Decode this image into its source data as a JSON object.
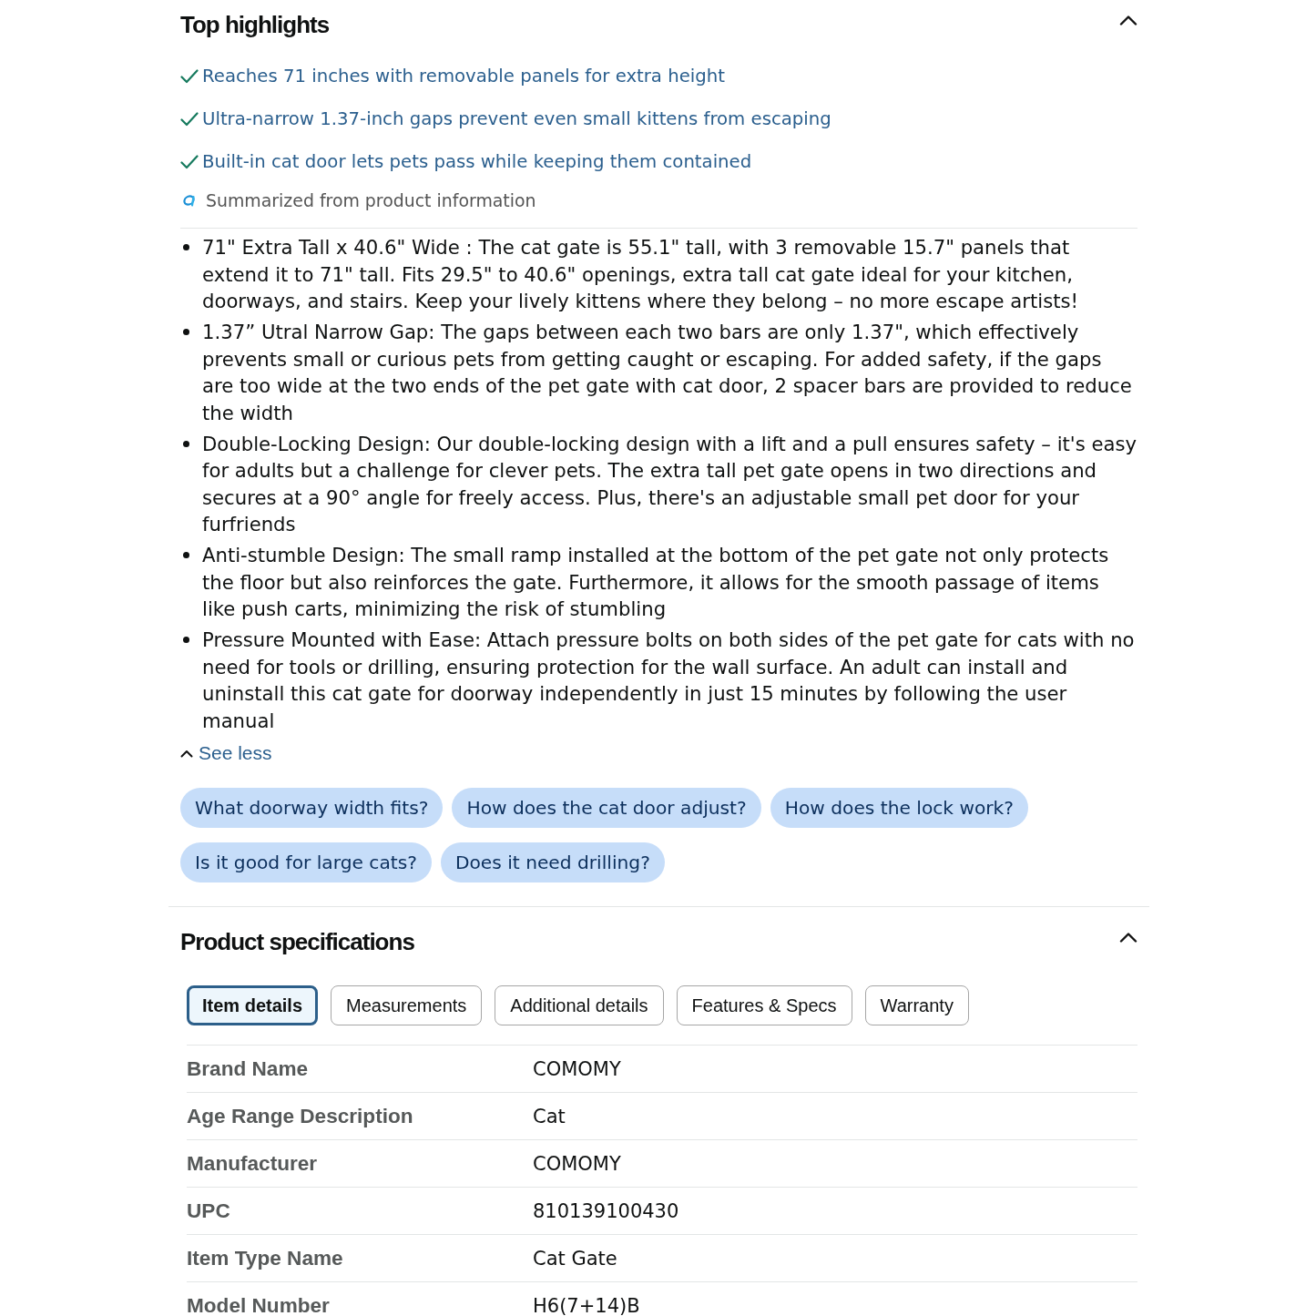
{
  "highlights": {
    "title": "Top highlights",
    "expanded": true,
    "items": [
      "Reaches 71 inches with removable panels for extra height",
      "Ultra-narrow 1.37-inch gaps prevent even small kittens from escaping",
      "Built-in cat door lets pets pass while keeping them contained"
    ],
    "source_note": "Summarized from product information"
  },
  "bullets": [
    "71\" Extra Tall x 40.6\" Wide : The cat gate is 55.1\" tall, with 3 removable 15.7\" panels that extend it to 71\" tall. Fits 29.5\" to 40.6\" openings, extra tall cat gate ideal for your kitchen, doorways, and stairs. Keep your lively kittens where they belong – no more escape artists!",
    "1.37” Utral Narrow Gap: The gaps between each two bars are only 1.37\", which effectively prevents small or curious pets from getting caught or escaping. For added safety, if the gaps are too wide at the two ends of the pet gate with cat door, 2 spacer bars are provided to reduce the width",
    "Double-Locking Design: Our double-locking design with a lift and a pull ensures safety – it's easy for adults but a challenge for clever pets. The extra tall pet gate opens in two directions and secures at a 90° angle for freely access. Plus, there's an adjustable small pet door for your furfriends",
    "Anti-stumble Design: The small ramp installed at the bottom of the pet gate not only protects the floor but also reinforces the gate. Furthermore, it allows for the smooth passage of items like push carts, minimizing the risk of stumbling",
    "Pressure Mounted with Ease: Attach pressure bolts on both sides of the pet gate for cats with no need for tools or drilling, ensuring protection for the wall surface. An adult can install and uninstall this cat gate for doorway independently in just 15 minutes by following the user manual"
  ],
  "see_less": "See less",
  "suggested_questions": [
    "What doorway width fits?",
    "How does the cat door adjust?",
    "How does the lock work?",
    "Is it good for large cats?",
    "Does it need drilling?"
  ],
  "specifications": {
    "title": "Product specifications",
    "expanded": true,
    "tabs": [
      {
        "label": "Item details",
        "selected": true
      },
      {
        "label": "Measurements",
        "selected": false
      },
      {
        "label": "Additional details",
        "selected": false
      },
      {
        "label": "Features & Specs",
        "selected": false
      },
      {
        "label": "Warranty",
        "selected": false
      }
    ],
    "rows": [
      {
        "label": "Brand Name",
        "value": "COMOMY"
      },
      {
        "label": "Age Range Description",
        "value": "Cat"
      },
      {
        "label": "Manufacturer",
        "value": "COMOMY"
      },
      {
        "label": "UPC",
        "value": "810139100430"
      },
      {
        "label": "Item Type Name",
        "value": "Cat Gate"
      },
      {
        "label": "Model Number",
        "value": "H6(7+14)B"
      }
    ]
  }
}
